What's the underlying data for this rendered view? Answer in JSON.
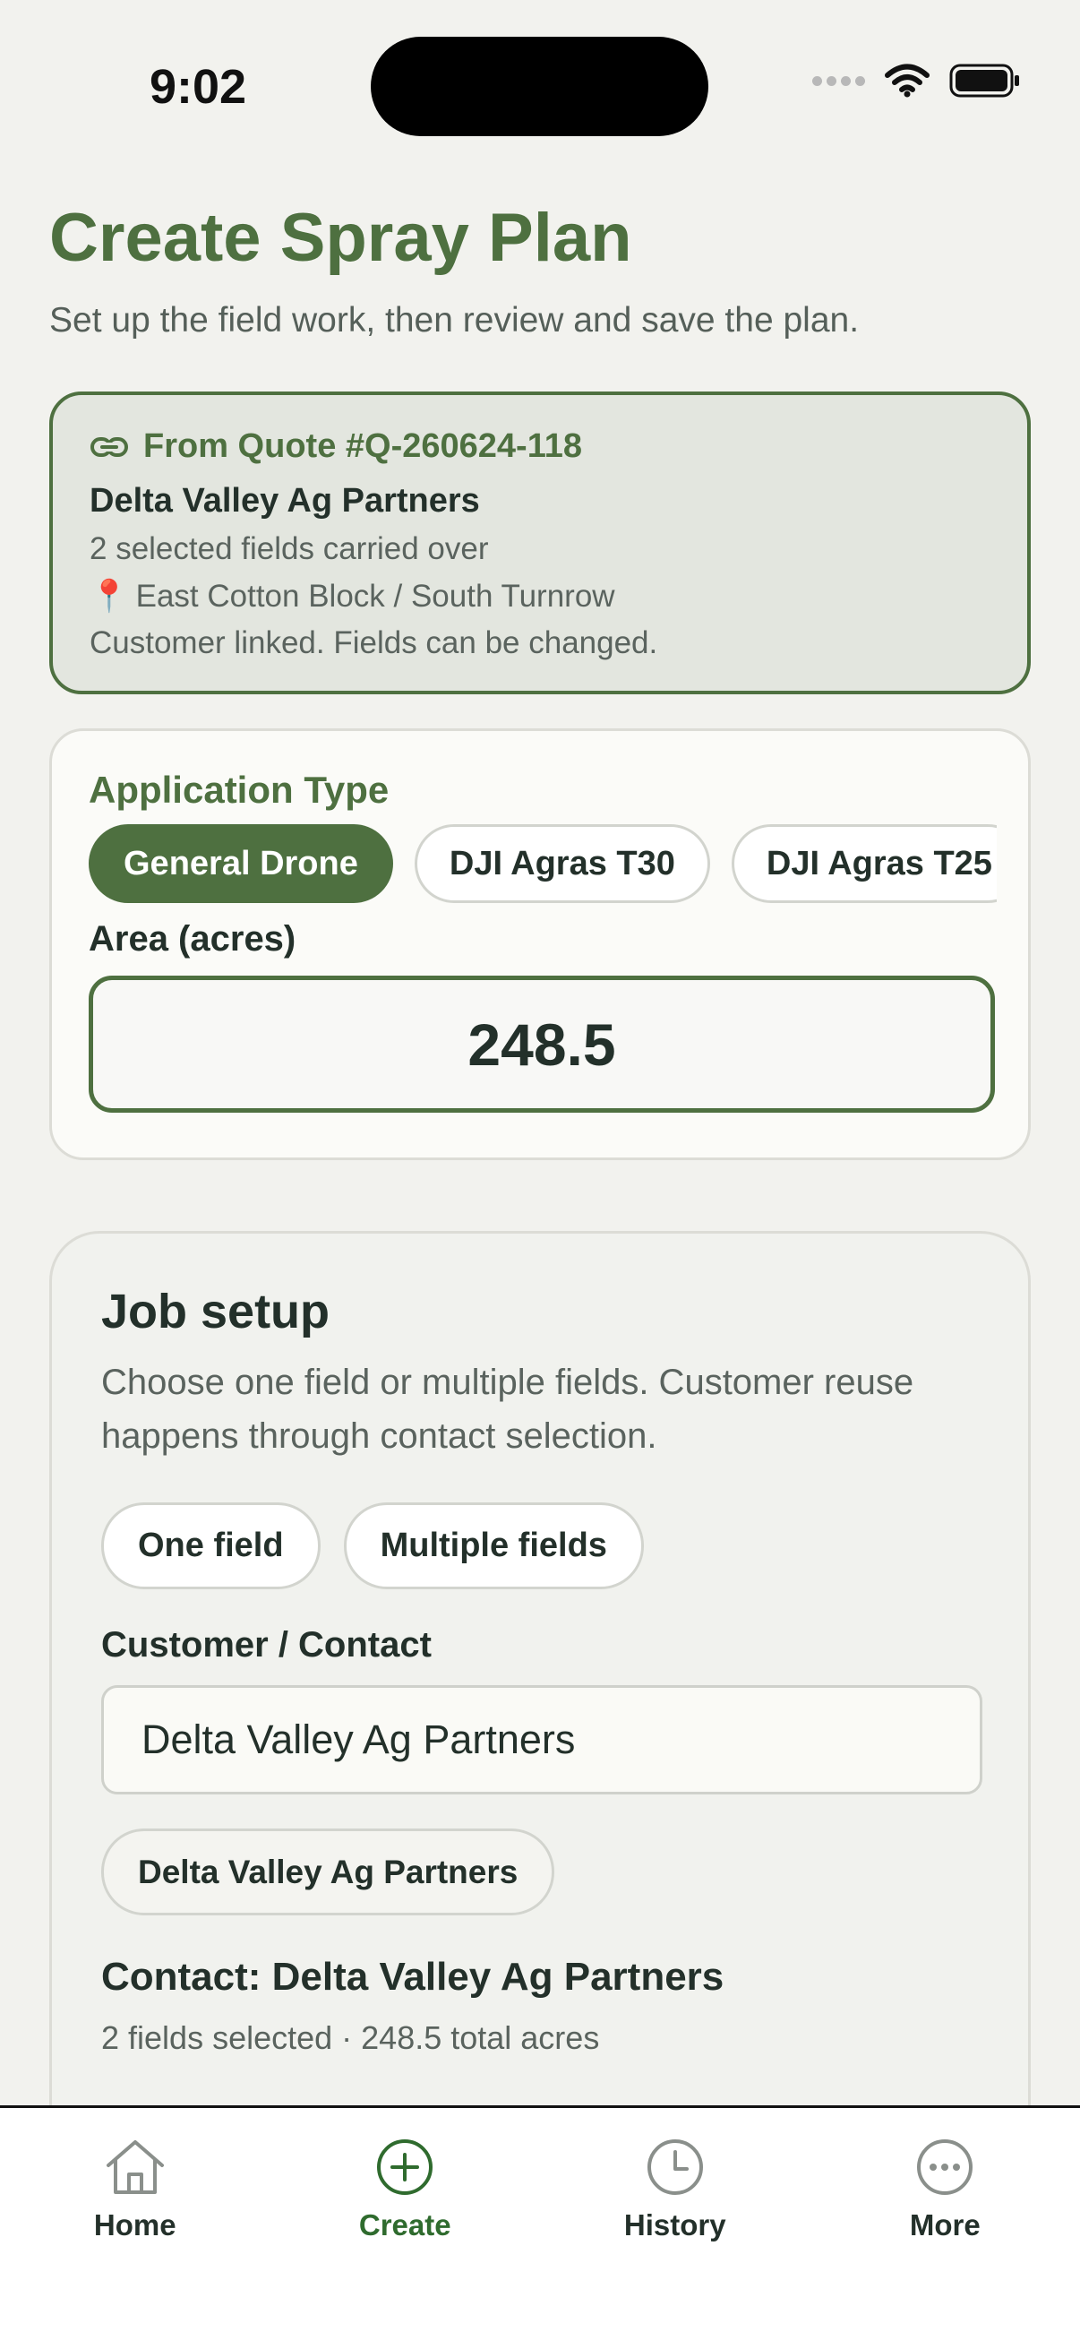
{
  "status_bar": {
    "time": "9:02"
  },
  "header": {
    "title": "Create Spray Plan",
    "subtitle": "Set up the field work, then review and save the plan."
  },
  "quote_card": {
    "icon": "link-icon",
    "title": "From Quote #Q-260624-118",
    "customer": "Delta Valley Ag Partners",
    "fields_line": "2 selected fields carried over",
    "location": "East Cotton Block / South Turnrow",
    "note": "Customer linked. Fields can be changed."
  },
  "application": {
    "label": "Application Type",
    "types": [
      "General Drone",
      "DJI Agras T30",
      "DJI Agras T25"
    ],
    "selected": "General Drone",
    "area_label": "Area (acres)",
    "area_value": "248.5"
  },
  "job_setup": {
    "title": "Job setup",
    "description": "Choose one field or multiple fields. Customer reuse happens through contact selection.",
    "modes": [
      "One field",
      "Multiple fields"
    ],
    "contact_label": "Customer / Contact",
    "contact_value": "Delta Valley Ag Partners",
    "suggestion": "Delta Valley Ag Partners",
    "contact_summary": "Contact: Delta Valley Ag Partners",
    "fields_summary": "2 fields selected · 248.5 total acres"
  },
  "tabs": [
    {
      "label": "Home",
      "icon": "house-icon"
    },
    {
      "label": "Create",
      "icon": "plus-circle-icon",
      "active": true
    },
    {
      "label": "History",
      "icon": "clock-icon"
    },
    {
      "label": "More",
      "icon": "more-icon"
    }
  ],
  "colors": {
    "accent": "#4e7040",
    "active_tab": "#2f6b2e",
    "background": "#f2f2ee"
  }
}
